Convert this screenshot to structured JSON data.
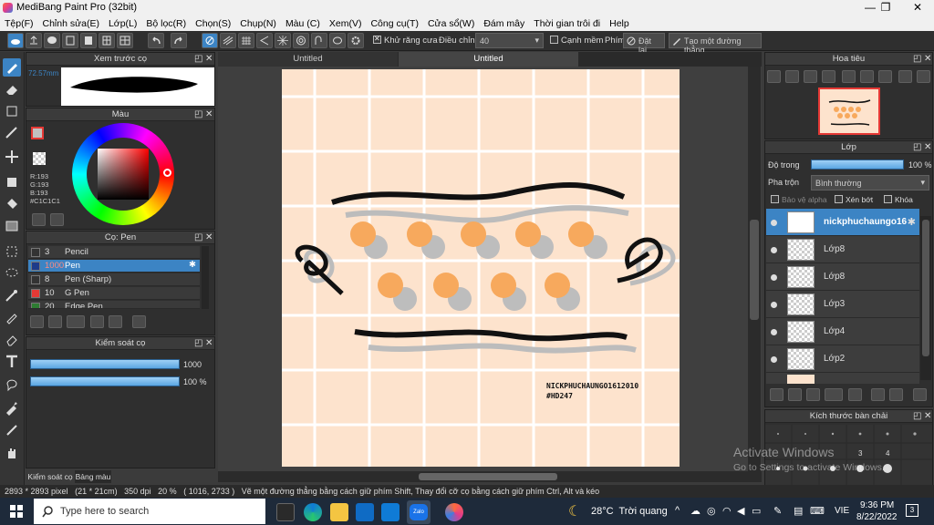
{
  "window": {
    "title": "MediBang Paint Pro (32bit)",
    "minimize": "—",
    "restore": "❐",
    "close": "✕"
  },
  "menu": [
    "Tệp(F)",
    "Chỉnh sửa(E)",
    "Lớp(L)",
    "Bộ lọc(R)",
    "Chọn(S)",
    "Chụp(N)",
    "Màu (C)",
    "Xem(V)",
    "Công cụ(T)",
    "Cửa sổ(W)",
    "Đám mây",
    "Thời gian trôi đi",
    "Help"
  ],
  "toolbar": {
    "antialias_label": "Khử răng cưa",
    "adjust_label": "Điều chỉnh",
    "adjust_value": "40",
    "snap_edge_label": "Cạnh mềm",
    "key_label": "Phím",
    "reset_label": "Đặt lại",
    "make_line_label": "Tạo một đường thẳng"
  },
  "preview": {
    "title": "Xem trước cọ",
    "size": "72.57mm"
  },
  "color": {
    "title": "Màu",
    "r": "R:193",
    "g": "G:193",
    "b": "B:193",
    "hex": "#C1C1C1",
    "current": "#c1c1c1"
  },
  "brushes": {
    "title": "Cọ: Pen",
    "items": [
      {
        "size": "3",
        "name": "Pencil",
        "color": "#333333"
      },
      {
        "size": "1000",
        "name": "Pen",
        "color": "#1e3a8a"
      },
      {
        "size": "8",
        "name": "Pen (Sharp)",
        "color": "#333333"
      },
      {
        "size": "10",
        "name": "G Pen",
        "color": "#e53935"
      },
      {
        "size": "20",
        "name": "Edge Pen",
        "color": "#2e7d32"
      }
    ]
  },
  "brush_control": {
    "title": "Kiểm soát cọ",
    "size_value": "1000",
    "opacity_value": "100 %",
    "size_fraction": 1.0,
    "opacity_fraction": 1.0
  },
  "bottom_tabs": [
    "Kiểm soát cọ",
    "Bảng màu"
  ],
  "doc_tabs": [
    "Untitled",
    "Untitled"
  ],
  "canvas_text": {
    "line1": "NICKPHUCHAUNGO1612010",
    "line2": "#HD247"
  },
  "navigator": {
    "title": "Hoa tiêu"
  },
  "layers": {
    "title": "Lớp",
    "opacity_label": "Độ trong",
    "opacity_value": "100 %",
    "blend_label": "Pha trộn",
    "blend_value": "Bình thường",
    "protect_alpha": "Bảo vệ alpha",
    "clip": "Xén bớt",
    "lock": "Khóa",
    "items": [
      "nickphuchaungo16",
      "Lớp8",
      "Lớp8",
      "Lớp3",
      "Lớp4",
      "Lớp2"
    ]
  },
  "brush_size_panel": {
    "title": "Kích thước bàn chải",
    "labels": [
      "3",
      "4"
    ]
  },
  "status": {
    "dims": "2893 * 2893 pixel",
    "cm": "(21 * 21cm)",
    "dpi": "350 dpi",
    "zoom": "20 %",
    "coords": "( 1016, 2733 )",
    "hint": "Vẽ một đường thẳng bằng cách giữ phím Shift, Thay đổi cỡ cọ bằng cách giữ phím Ctrl, Alt và kéo"
  },
  "activate": {
    "line1": "Activate Windows",
    "line2": "Go to Settings to activate Windows."
  },
  "taskbar": {
    "search_placeholder": "Type here to search",
    "weather": "28°C  Trời quang",
    "lang": "VIE",
    "time": "9:36 PM",
    "date": "8/22/2022",
    "notif": "3"
  }
}
